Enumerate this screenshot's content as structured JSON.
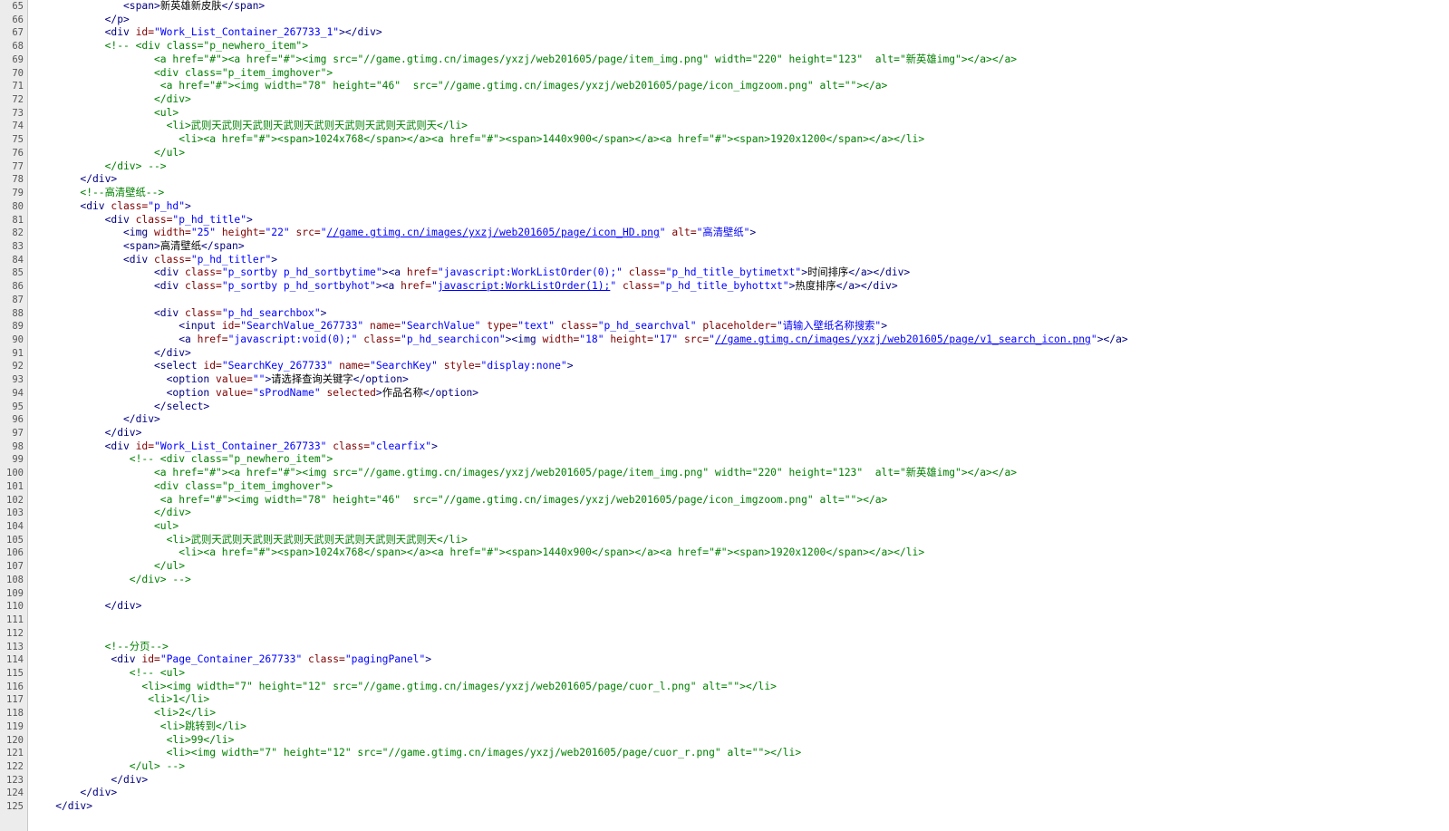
{
  "editor": {
    "colors": {
      "tag": "#000080",
      "attribute": "#800000",
      "value": "#0000ff",
      "comment": "#008000",
      "text": "#000000",
      "gutter": "#ececec",
      "line_number": "#555555"
    },
    "lines": [
      {
        "no": "65",
        "indent": 15,
        "segs": [
          [
            "t",
            "<span>"
          ],
          [
            "s",
            "新英雄新皮肤"
          ],
          [
            "t",
            "</span>"
          ]
        ]
      },
      {
        "no": "66",
        "indent": 12,
        "segs": [
          [
            "t",
            "</p>"
          ]
        ]
      },
      {
        "no": "67",
        "indent": 12,
        "segs": [
          [
            "t",
            "<div "
          ],
          [
            "a",
            "id="
          ],
          [
            "v",
            "\"Work_List_Container_267733_1\""
          ],
          [
            "t",
            "></div>"
          ]
        ]
      },
      {
        "no": "68",
        "indent": 12,
        "segs": [
          [
            "c",
            "<!-- <div class=\"p_newhero_item\">"
          ]
        ]
      },
      {
        "no": "69",
        "indent": 20,
        "segs": [
          [
            "c",
            "<a href=\"#\"><a href=\"#\"><img src=\"//game.gtimg.cn/images/yxzj/web201605/page/item_img.png\" width=\"220\" height=\"123\"  alt=\"新英雄img\"></a></a>"
          ]
        ]
      },
      {
        "no": "70",
        "indent": 20,
        "segs": [
          [
            "c",
            "<div class=\"p_item_imghover\">"
          ]
        ]
      },
      {
        "no": "71",
        "indent": 21,
        "segs": [
          [
            "c",
            "<a href=\"#\"><img width=\"78\" height=\"46\"  src=\"//game.gtimg.cn/images/yxzj/web201605/page/icon_imgzoom.png\" alt=\"\"></a>"
          ]
        ]
      },
      {
        "no": "72",
        "indent": 20,
        "segs": [
          [
            "c",
            "</div>"
          ]
        ]
      },
      {
        "no": "73",
        "indent": 20,
        "segs": [
          [
            "c",
            "<ul>"
          ]
        ]
      },
      {
        "no": "74",
        "indent": 22,
        "segs": [
          [
            "c",
            "<li>武则天武则天武则天武则天武则天武则天武则天武则天</li>"
          ]
        ]
      },
      {
        "no": "75",
        "indent": 24,
        "segs": [
          [
            "c",
            "<li><a href=\"#\"><span>1024x768</span></a><a href=\"#\"><span>1440x900</span></a><a href=\"#\"><span>1920x1200</span></a></li>"
          ]
        ]
      },
      {
        "no": "76",
        "indent": 20,
        "segs": [
          [
            "c",
            "</ul>"
          ]
        ]
      },
      {
        "no": "77",
        "indent": 12,
        "segs": [
          [
            "c",
            "</div> -->"
          ]
        ]
      },
      {
        "no": "78",
        "indent": 8,
        "segs": [
          [
            "t",
            "</div>"
          ]
        ]
      },
      {
        "no": "79",
        "indent": 8,
        "segs": [
          [
            "c",
            "<!--高清壁纸-->"
          ]
        ]
      },
      {
        "no": "80",
        "indent": 8,
        "segs": [
          [
            "t",
            "<div "
          ],
          [
            "a",
            "class="
          ],
          [
            "v",
            "\"p_hd\""
          ],
          [
            "t",
            ">"
          ]
        ]
      },
      {
        "no": "81",
        "indent": 12,
        "segs": [
          [
            "t",
            "<div "
          ],
          [
            "a",
            "class="
          ],
          [
            "v",
            "\"p_hd_title\""
          ],
          [
            "t",
            ">"
          ]
        ]
      },
      {
        "no": "82",
        "indent": 15,
        "segs": [
          [
            "t",
            "<img "
          ],
          [
            "a",
            "width="
          ],
          [
            "v",
            "\"25\""
          ],
          [
            "a",
            " height="
          ],
          [
            "v",
            "\"22\""
          ],
          [
            "a",
            " src="
          ],
          [
            "v",
            "\""
          ],
          [
            "u",
            "//game.gtimg.cn/images/yxzj/web201605/page/icon_HD.png"
          ],
          [
            "v",
            "\""
          ],
          [
            "a",
            " alt="
          ],
          [
            "v",
            "\"高清壁纸\""
          ],
          [
            "t",
            ">"
          ]
        ]
      },
      {
        "no": "83",
        "indent": 15,
        "segs": [
          [
            "t",
            "<span>"
          ],
          [
            "s",
            "高清壁纸"
          ],
          [
            "t",
            "</span>"
          ]
        ]
      },
      {
        "no": "84",
        "indent": 15,
        "segs": [
          [
            "t",
            "<div "
          ],
          [
            "a",
            "class="
          ],
          [
            "v",
            "\"p_hd_titler\""
          ],
          [
            "t",
            ">"
          ]
        ]
      },
      {
        "no": "85",
        "indent": 20,
        "segs": [
          [
            "t",
            "<div "
          ],
          [
            "a",
            "class="
          ],
          [
            "v",
            "\"p_sortby p_hd_sortbytime\""
          ],
          [
            "t",
            "><a "
          ],
          [
            "a",
            "href="
          ],
          [
            "v",
            "\"javascript:WorkListOrder(0);\""
          ],
          [
            "a",
            " class="
          ],
          [
            "v",
            "\"p_hd_title_bytimetxt\""
          ],
          [
            "t",
            ">"
          ],
          [
            "s",
            "时间排序"
          ],
          [
            "t",
            "</a></div>"
          ]
        ]
      },
      {
        "no": "86",
        "indent": 20,
        "segs": [
          [
            "t",
            "<div "
          ],
          [
            "a",
            "class="
          ],
          [
            "v",
            "\"p_sortby p_hd_sortbyhot\""
          ],
          [
            "t",
            "><a "
          ],
          [
            "a",
            "href="
          ],
          [
            "v",
            "\""
          ],
          [
            "u",
            "javascript:WorkListOrder(1);"
          ],
          [
            "v",
            "\""
          ],
          [
            "a",
            " class="
          ],
          [
            "v",
            "\"p_hd_title_byhottxt\""
          ],
          [
            "t",
            ">"
          ],
          [
            "s",
            "热度排序"
          ],
          [
            "t",
            "</a></div>"
          ]
        ]
      },
      {
        "no": "87",
        "indent": 0,
        "segs": []
      },
      {
        "no": "88",
        "indent": 20,
        "segs": [
          [
            "t",
            "<div "
          ],
          [
            "a",
            "class="
          ],
          [
            "v",
            "\"p_hd_searchbox\""
          ],
          [
            "t",
            ">"
          ]
        ]
      },
      {
        "no": "89",
        "indent": 24,
        "segs": [
          [
            "t",
            "<input "
          ],
          [
            "a",
            "id="
          ],
          [
            "v",
            "\"SearchValue_267733\""
          ],
          [
            "a",
            " name="
          ],
          [
            "v",
            "\"SearchValue\""
          ],
          [
            "a",
            " type="
          ],
          [
            "v",
            "\"text\""
          ],
          [
            "a",
            " class="
          ],
          [
            "v",
            "\"p_hd_searchval\""
          ],
          [
            "a",
            " placeholder="
          ],
          [
            "v",
            "\"请输入壁纸名称搜索\""
          ],
          [
            "t",
            ">"
          ]
        ]
      },
      {
        "no": "90",
        "indent": 24,
        "segs": [
          [
            "t",
            "<a "
          ],
          [
            "a",
            "href="
          ],
          [
            "v",
            "\"javascript:void(0);\""
          ],
          [
            "a",
            " class="
          ],
          [
            "v",
            "\"p_hd_searchicon\""
          ],
          [
            "t",
            "><img "
          ],
          [
            "a",
            "width="
          ],
          [
            "v",
            "\"18\""
          ],
          [
            "a",
            " height="
          ],
          [
            "v",
            "\"17\""
          ],
          [
            "a",
            " src="
          ],
          [
            "v",
            "\""
          ],
          [
            "u",
            "//game.gtimg.cn/images/yxzj/web201605/page/v1_search_icon.png"
          ],
          [
            "v",
            "\""
          ],
          [
            "t",
            "></a>"
          ]
        ]
      },
      {
        "no": "91",
        "indent": 20,
        "segs": [
          [
            "t",
            "</div>"
          ]
        ]
      },
      {
        "no": "92",
        "indent": 20,
        "segs": [
          [
            "t",
            "<select "
          ],
          [
            "a",
            "id="
          ],
          [
            "v",
            "\"SearchKey_267733\""
          ],
          [
            "a",
            " name="
          ],
          [
            "v",
            "\"SearchKey\""
          ],
          [
            "a",
            " style="
          ],
          [
            "v",
            "\"display:none\""
          ],
          [
            "t",
            ">"
          ]
        ]
      },
      {
        "no": "93",
        "indent": 22,
        "segs": [
          [
            "t",
            "<option "
          ],
          [
            "a",
            "value="
          ],
          [
            "v",
            "\"\""
          ],
          [
            "t",
            ">"
          ],
          [
            "s",
            "请选择查询关键字"
          ],
          [
            "t",
            "</option>"
          ]
        ]
      },
      {
        "no": "94",
        "indent": 22,
        "segs": [
          [
            "t",
            "<option "
          ],
          [
            "a",
            "value="
          ],
          [
            "v",
            "\"sProdName\""
          ],
          [
            "a",
            " selected"
          ],
          [
            "t",
            ">"
          ],
          [
            "s",
            "作品名称"
          ],
          [
            "t",
            "</option>"
          ]
        ]
      },
      {
        "no": "95",
        "indent": 20,
        "segs": [
          [
            "t",
            "</select>"
          ]
        ]
      },
      {
        "no": "96",
        "indent": 15,
        "segs": [
          [
            "t",
            "</div>"
          ]
        ]
      },
      {
        "no": "97",
        "indent": 12,
        "segs": [
          [
            "t",
            "</div>"
          ]
        ]
      },
      {
        "no": "98",
        "indent": 12,
        "segs": [
          [
            "t",
            "<div "
          ],
          [
            "a",
            "id="
          ],
          [
            "v",
            "\"Work_List_Container_267733\""
          ],
          [
            "a",
            " class="
          ],
          [
            "v",
            "\"clearfix\""
          ],
          [
            "t",
            ">"
          ]
        ]
      },
      {
        "no": "99",
        "indent": 16,
        "segs": [
          [
            "c",
            "<!-- <div class=\"p_newhero_item\">"
          ]
        ]
      },
      {
        "no": "100",
        "indent": 20,
        "segs": [
          [
            "c",
            "<a href=\"#\"><a href=\"#\"><img src=\"//game.gtimg.cn/images/yxzj/web201605/page/item_img.png\" width=\"220\" height=\"123\"  alt=\"新英雄img\"></a></a>"
          ]
        ]
      },
      {
        "no": "101",
        "indent": 20,
        "segs": [
          [
            "c",
            "<div class=\"p_item_imghover\">"
          ]
        ]
      },
      {
        "no": "102",
        "indent": 21,
        "segs": [
          [
            "c",
            "<a href=\"#\"><img width=\"78\" height=\"46\"  src=\"//game.gtimg.cn/images/yxzj/web201605/page/icon_imgzoom.png\" alt=\"\"></a>"
          ]
        ]
      },
      {
        "no": "103",
        "indent": 20,
        "segs": [
          [
            "c",
            "</div>"
          ]
        ]
      },
      {
        "no": "104",
        "indent": 20,
        "segs": [
          [
            "c",
            "<ul>"
          ]
        ]
      },
      {
        "no": "105",
        "indent": 22,
        "segs": [
          [
            "c",
            "<li>武则天武则天武则天武则天武则天武则天武则天武则天</li>"
          ]
        ]
      },
      {
        "no": "106",
        "indent": 24,
        "segs": [
          [
            "c",
            "<li><a href=\"#\"><span>1024x768</span></a><a href=\"#\"><span>1440x900</span></a><a href=\"#\"><span>1920x1200</span></a></li>"
          ]
        ]
      },
      {
        "no": "107",
        "indent": 20,
        "segs": [
          [
            "c",
            "</ul>"
          ]
        ]
      },
      {
        "no": "108",
        "indent": 16,
        "segs": [
          [
            "c",
            "</div> -->"
          ]
        ]
      },
      {
        "no": "109",
        "indent": 0,
        "segs": []
      },
      {
        "no": "110",
        "indent": 12,
        "segs": [
          [
            "t",
            "</div>"
          ]
        ]
      },
      {
        "no": "111",
        "indent": 0,
        "segs": []
      },
      {
        "no": "112",
        "indent": 0,
        "segs": []
      },
      {
        "no": "113",
        "indent": 12,
        "segs": [
          [
            "c",
            "<!--分页-->"
          ]
        ]
      },
      {
        "no": "114",
        "indent": 13,
        "segs": [
          [
            "t",
            "<div "
          ],
          [
            "a",
            "id="
          ],
          [
            "v",
            "\"Page_Container_267733\""
          ],
          [
            "a",
            " class="
          ],
          [
            "v",
            "\"pagingPanel\""
          ],
          [
            "t",
            ">"
          ]
        ]
      },
      {
        "no": "115",
        "indent": 16,
        "segs": [
          [
            "c",
            "<!-- <ul>"
          ]
        ]
      },
      {
        "no": "116",
        "indent": 18,
        "segs": [
          [
            "c",
            "<li><img width=\"7\" height=\"12\" src=\"//game.gtimg.cn/images/yxzj/web201605/page/cuor_l.png\" alt=\"\"></li>"
          ]
        ]
      },
      {
        "no": "117",
        "indent": 19,
        "segs": [
          [
            "c",
            "<li>1</li>"
          ]
        ]
      },
      {
        "no": "118",
        "indent": 20,
        "segs": [
          [
            "c",
            "<li>2</li>"
          ]
        ]
      },
      {
        "no": "119",
        "indent": 21,
        "segs": [
          [
            "c",
            "<li>跳转到</li>"
          ]
        ]
      },
      {
        "no": "120",
        "indent": 22,
        "segs": [
          [
            "c",
            "<li>99</li>"
          ]
        ]
      },
      {
        "no": "121",
        "indent": 22,
        "segs": [
          [
            "c",
            "<li><img width=\"7\" height=\"12\" src=\"//game.gtimg.cn/images/yxzj/web201605/page/cuor_r.png\" alt=\"\"></li>"
          ]
        ]
      },
      {
        "no": "122",
        "indent": 16,
        "segs": [
          [
            "c",
            "</ul> -->"
          ]
        ]
      },
      {
        "no": "123",
        "indent": 13,
        "segs": [
          [
            "t",
            "</div>"
          ]
        ]
      },
      {
        "no": "124",
        "indent": 8,
        "segs": [
          [
            "t",
            "</div>"
          ]
        ]
      },
      {
        "no": "125",
        "indent": 4,
        "segs": [
          [
            "t",
            "</div>"
          ]
        ]
      }
    ]
  }
}
